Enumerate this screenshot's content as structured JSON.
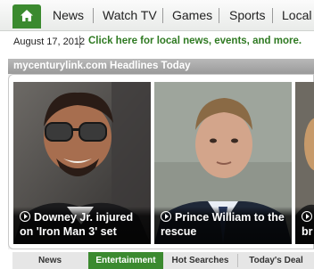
{
  "nav": {
    "home_icon": "home-icon",
    "items": [
      "News",
      "Watch TV",
      "Games",
      "Sports",
      "Local"
    ]
  },
  "info": {
    "date": "August 17, 2012",
    "local_link": "Click here for local news, events, and more."
  },
  "headlines": {
    "title": "mycenturylink.com Headlines Today",
    "stories": [
      {
        "line1": "Downey Jr. injured",
        "line2": "on 'Iron Man 3' set"
      },
      {
        "line1": "Prince William to the",
        "line2": "rescue"
      },
      {
        "line1": "",
        "line2": "br"
      }
    ]
  },
  "tabs": {
    "items": [
      "News",
      "Entertainment",
      "Hot Searches",
      "Today's Deal"
    ],
    "active": "Entertainment"
  },
  "colors": {
    "brand_green": "#3b8a2f",
    "link_green": "#2f7a22"
  }
}
